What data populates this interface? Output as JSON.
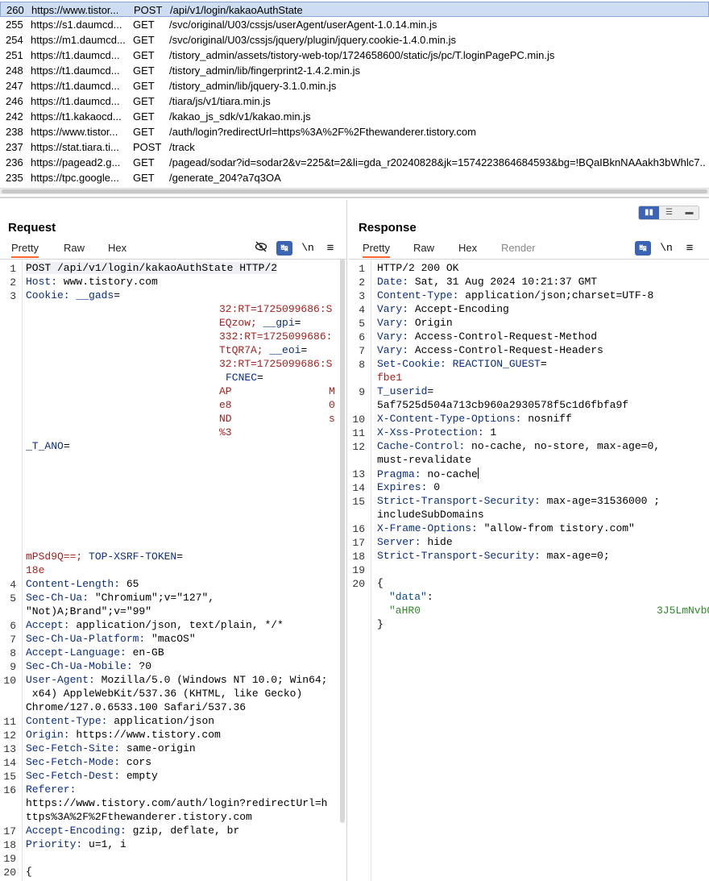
{
  "history": [
    {
      "num": "260",
      "host": "https://www.tistor...",
      "method": "POST",
      "url": "/api/v1/login/kakaoAuthState"
    },
    {
      "num": "255",
      "host": "https://s1.daumcd...",
      "method": "GET",
      "url": "/svc/original/U03/cssjs/userAgent/userAgent-1.0.14.min.js"
    },
    {
      "num": "254",
      "host": "https://m1.daumcd...",
      "method": "GET",
      "url": "/svc/original/U03/cssjs/jquery/plugin/jquery.cookie-1.4.0.min.js"
    },
    {
      "num": "251",
      "host": "https://t1.daumcd...",
      "method": "GET",
      "url": "/tistory_admin/assets/tistory-web-top/1724658600/static/js/pc/T.loginPagePC.min.js"
    },
    {
      "num": "248",
      "host": "https://t1.daumcd...",
      "method": "GET",
      "url": "/tistory_admin/lib/fingerprint2-1.4.2.min.js"
    },
    {
      "num": "247",
      "host": "https://t1.daumcd...",
      "method": "GET",
      "url": "/tistory_admin/lib/jquery-3.1.0.min.js"
    },
    {
      "num": "246",
      "host": "https://t1.daumcd...",
      "method": "GET",
      "url": "/tiara/js/v1/tiara.min.js"
    },
    {
      "num": "242",
      "host": "https://t1.kakaocd...",
      "method": "GET",
      "url": "/kakao_js_sdk/v1/kakao.min.js"
    },
    {
      "num": "238",
      "host": "https://www.tistor...",
      "method": "GET",
      "url": "/auth/login?redirectUrl=https%3A%2F%2Fthewanderer.tistory.com"
    },
    {
      "num": "237",
      "host": "https://stat.tiara.ti...",
      "method": "POST",
      "url": "/track"
    },
    {
      "num": "236",
      "host": "https://pagead2.g...",
      "method": "GET",
      "url": "/pagead/sodar?id=sodar2&v=225&t=2&li=gda_r20240828&jk=1574223864684593&bg=!BQaIBknNAAakh3bWhlc7..."
    },
    {
      "num": "235",
      "host": "https://tpc.google...",
      "method": "GET",
      "url": "/generate_204?a7q3OA"
    }
  ],
  "request": {
    "title": "Request",
    "tabs": [
      "Pretty",
      "Raw",
      "Hex"
    ],
    "icons": [
      "eye-off-icon",
      "wrap-icon",
      "newline-icon",
      "menu-icon"
    ],
    "newline_label": "\\n",
    "lines": {
      "l1": "POST /api/v1/login/kakaoAuthState HTTP/2",
      "l2k": "Host:",
      "l2v": " www.tistory.com",
      "l3k": "Cookie:",
      "l3c": "__gads",
      "l3e": "=",
      "ck1": "32:RT=1725099686:S",
      "ck2a": "EQzow; ",
      "ck2b": "__gpi",
      "ck2c": "=",
      "ck3": "332:RT=1725099686:",
      "ck4a": "TtQR7A; ",
      "ck4b": "__eoi",
      "ck4c": "=",
      "ck5": "32:RT=1725099686:S",
      "ck6": "FCNEC",
      "ck6e": "=",
      "ck7a": "AP",
      "ck7b": "M",
      "ck8a": "e8",
      "ck8b": "0",
      "ck9a": "ND",
      "ck9b": "s",
      "ck10": "%3",
      "ck11": "_T_ANO",
      "ck11e": "=",
      "ck12a": "mPSd9Q==; ",
      "ck12b": "TOP-XSRF-TOKEN",
      "ck12c": "=",
      "ck13": "18e",
      "l4k": "Content-Length:",
      "l4v": " 65",
      "l5k": "Sec-Ch-Ua:",
      "l5v": " \"Chromium\";v=\"127\",",
      "l5w": "\"Not)A;Brand\";v=\"99\"",
      "l6k": "Accept:",
      "l6v": " application/json, text/plain, */*",
      "l7k": "Sec-Ch-Ua-Platform:",
      "l7v": " \"macOS\"",
      "l8k": "Accept-Language:",
      "l8v": " en-GB",
      "l9k": "Sec-Ch-Ua-Mobile:",
      "l9v": " ?0",
      "l10k": "User-Agent:",
      "l10v": " Mozilla/5.0 (Windows NT 10.0; Win64;",
      "l10w": " x64) AppleWebKit/537.36 (KHTML, like Gecko)",
      "l10x": "Chrome/127.0.6533.100 Safari/537.36",
      "l11k": "Content-Type:",
      "l11v": " application/json",
      "l12k": "Origin:",
      "l12v": " https://www.tistory.com",
      "l13k": "Sec-Fetch-Site:",
      "l13v": " same-origin",
      "l14k": "Sec-Fetch-Mode:",
      "l14v": " cors",
      "l15k": "Sec-Fetch-Dest:",
      "l15v": " empty",
      "l16k": "Referer:",
      "l16v": "https://www.tistory.com/auth/login?redirectUrl=h",
      "l16w": "ttps%3A%2F%2Fthewanderer.tistory.com",
      "l17k": "Accept-Encoding:",
      "l17v": " gzip, deflate, br",
      "l18k": "Priority:",
      "l18v": " u=1, i",
      "l20": "{"
    }
  },
  "response": {
    "title": "Response",
    "tabs": [
      "Pretty",
      "Raw",
      "Hex",
      "Render"
    ],
    "view_buttons": [
      "split-view",
      "horizontal-view",
      "collapse-view"
    ],
    "newline_label": "\\n",
    "lines": {
      "l1": "HTTP/2 200 OK",
      "l2k": "Date:",
      "l2v": " Sat, 31 Aug 2024 10:21:37 GMT",
      "l3k": "Content-Type:",
      "l3v": " application/json;charset=UTF-8",
      "l4k": "Vary:",
      "l4v": " Accept-Encoding",
      "l5k": "Vary:",
      "l5v": " Origin",
      "l6k": "Vary:",
      "l6v": " Access-Control-Request-Method",
      "l7k": "Vary:",
      "l7v": " Access-Control-Request-Headers",
      "l8k": "Set-Cookie:",
      "l8c": "REACTION_GUEST",
      "l8e": "=",
      "l8w": "fbe1",
      "l9k": "T_userid",
      "l9e": "=",
      "l9w": "5af7525d504a713cb960a2930578f5c1d6fbfa9f",
      "l10k": "X-Content-Type-Options:",
      "l10v": " nosniff",
      "l11k": "X-Xss-Protection:",
      "l11v": " 1",
      "l12k": "Cache-Control:",
      "l12v": " no-cache, no-store, max-age=0,",
      "l12w": "must-revalidate",
      "l13k": "Pragma:",
      "l13v": " no-cache",
      "l14k": "Expires:",
      "l14v": " 0",
      "l15k": "Strict-Transport-Security:",
      "l15v": " max-age=31536000 ;",
      "l15w": "includeSubDomains",
      "l16k": "X-Frame-Options:",
      "l16v": " \"allow-from tistory.com\"",
      "l17k": "Server:",
      "l17v": " hide",
      "l18k": "Strict-Transport-Security:",
      "l18v": " max-age=0;",
      "l20": "{",
      "l21k": "\"data\"",
      "l21e": ":",
      "l22a": "\"aHR0",
      "l22b": "3J5LmNvbQ\"",
      "l23": "}"
    }
  }
}
